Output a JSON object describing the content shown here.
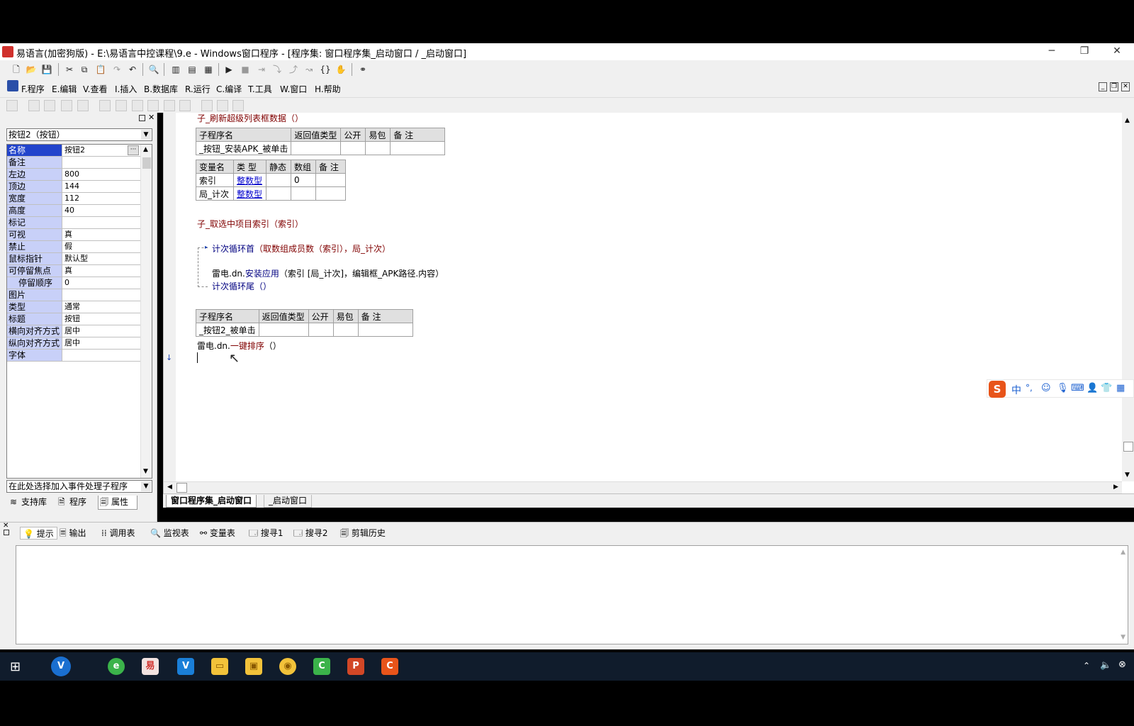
{
  "window": {
    "title": "易语言(加密狗版) - E:\\易语言中控课程\\9.e - Windows窗口程序 - [程序集: 窗口程序集_启动窗口 / _启动窗口]",
    "minimize": "─",
    "restore": "❐",
    "close": "✕"
  },
  "menu": [
    {
      "label": "F.程序"
    },
    {
      "label": "E.编辑"
    },
    {
      "label": "V.查看"
    },
    {
      "label": "I.插入"
    },
    {
      "label": "B.数据库"
    },
    {
      "label": "R.运行"
    },
    {
      "label": "C.编译"
    },
    {
      "label": "T.工具"
    },
    {
      "label": "W.窗口"
    },
    {
      "label": "H.帮助"
    }
  ],
  "properties": {
    "selected_object": "按钮2（按钮）",
    "rows": [
      {
        "name": "名称",
        "value": "按钮2"
      },
      {
        "name": "备注",
        "value": ""
      },
      {
        "name": "左边",
        "value": "800"
      },
      {
        "name": "顶边",
        "value": "144"
      },
      {
        "name": "宽度",
        "value": "112"
      },
      {
        "name": "高度",
        "value": "40"
      },
      {
        "name": "标记",
        "value": ""
      },
      {
        "name": "可视",
        "value": "真"
      },
      {
        "name": "禁止",
        "value": "假"
      },
      {
        "name": "鼠标指针",
        "value": "默认型"
      },
      {
        "name": "可停留焦点",
        "value": "真"
      },
      {
        "name": "停留顺序",
        "value": "0"
      },
      {
        "name": "图片",
        "value": ""
      },
      {
        "name": "类型",
        "value": "通常"
      },
      {
        "name": "标题",
        "value": "按钮"
      },
      {
        "name": "横向对齐方式",
        "value": "居中"
      },
      {
        "name": "纵向对齐方式",
        "value": "居中"
      },
      {
        "name": "字体",
        "value": ""
      }
    ],
    "event_combo": "在此处选择加入事件处理子程序"
  },
  "left_tabs": [
    {
      "label": "支持库"
    },
    {
      "label": "程序"
    },
    {
      "label": "属性"
    }
  ],
  "code": {
    "line1": "子_刷新超级列表框数据（）",
    "table1": {
      "headers": [
        "子程序名",
        "返回值类型",
        "公开",
        "易包",
        "备 注"
      ],
      "row": [
        "_按钮_安装APK_被单击",
        "",
        "",
        "",
        ""
      ]
    },
    "vartable": {
      "headers": [
        "变量名",
        "类 型",
        "静态",
        "数组",
        "备 注"
      ],
      "rows": [
        [
          "索引",
          "整数型",
          "",
          "0",
          ""
        ],
        [
          "局_计次",
          "整数型",
          "",
          "",
          ""
        ]
      ]
    },
    "line2": "子_取选中项目索引（索引）",
    "loop_head_kw": "计次循环首",
    "loop_head_args": "（取数组成员数（索引），局_计次）",
    "install_obj": "雷电.dn.",
    "install_fn": "安装应用",
    "install_args": "（索引 [局_计次]，编辑框_APK路径.内容）",
    "loop_tail": "计次循环尾（）",
    "table2": {
      "headers": [
        "子程序名",
        "返回值类型",
        "公开",
        "易包",
        "备 注"
      ],
      "row": [
        "_按钮2_被单击",
        "",
        "",
        "",
        ""
      ]
    },
    "sort_obj": "雷电.dn.",
    "sort_fn": "一键排序",
    "sort_args": "（）"
  },
  "editor_tabs": [
    {
      "label": "窗口程序集_启动窗口"
    },
    {
      "label": "_启动窗口"
    }
  ],
  "bottom_tabs": [
    {
      "label": "提示"
    },
    {
      "label": "输出"
    },
    {
      "label": "调用表"
    },
    {
      "label": "监视表"
    },
    {
      "label": "变量表"
    },
    {
      "label": "搜寻1"
    },
    {
      "label": "搜寻2"
    },
    {
      "label": "剪辑历史"
    }
  ],
  "ime": {
    "mode": "中",
    "punct": "°,"
  },
  "colors": {
    "selection": "#2244cc",
    "prop_name_bg": "#c8d0f8",
    "keyword": "#800000",
    "call": "#000080",
    "type_link": "#0000cc"
  }
}
